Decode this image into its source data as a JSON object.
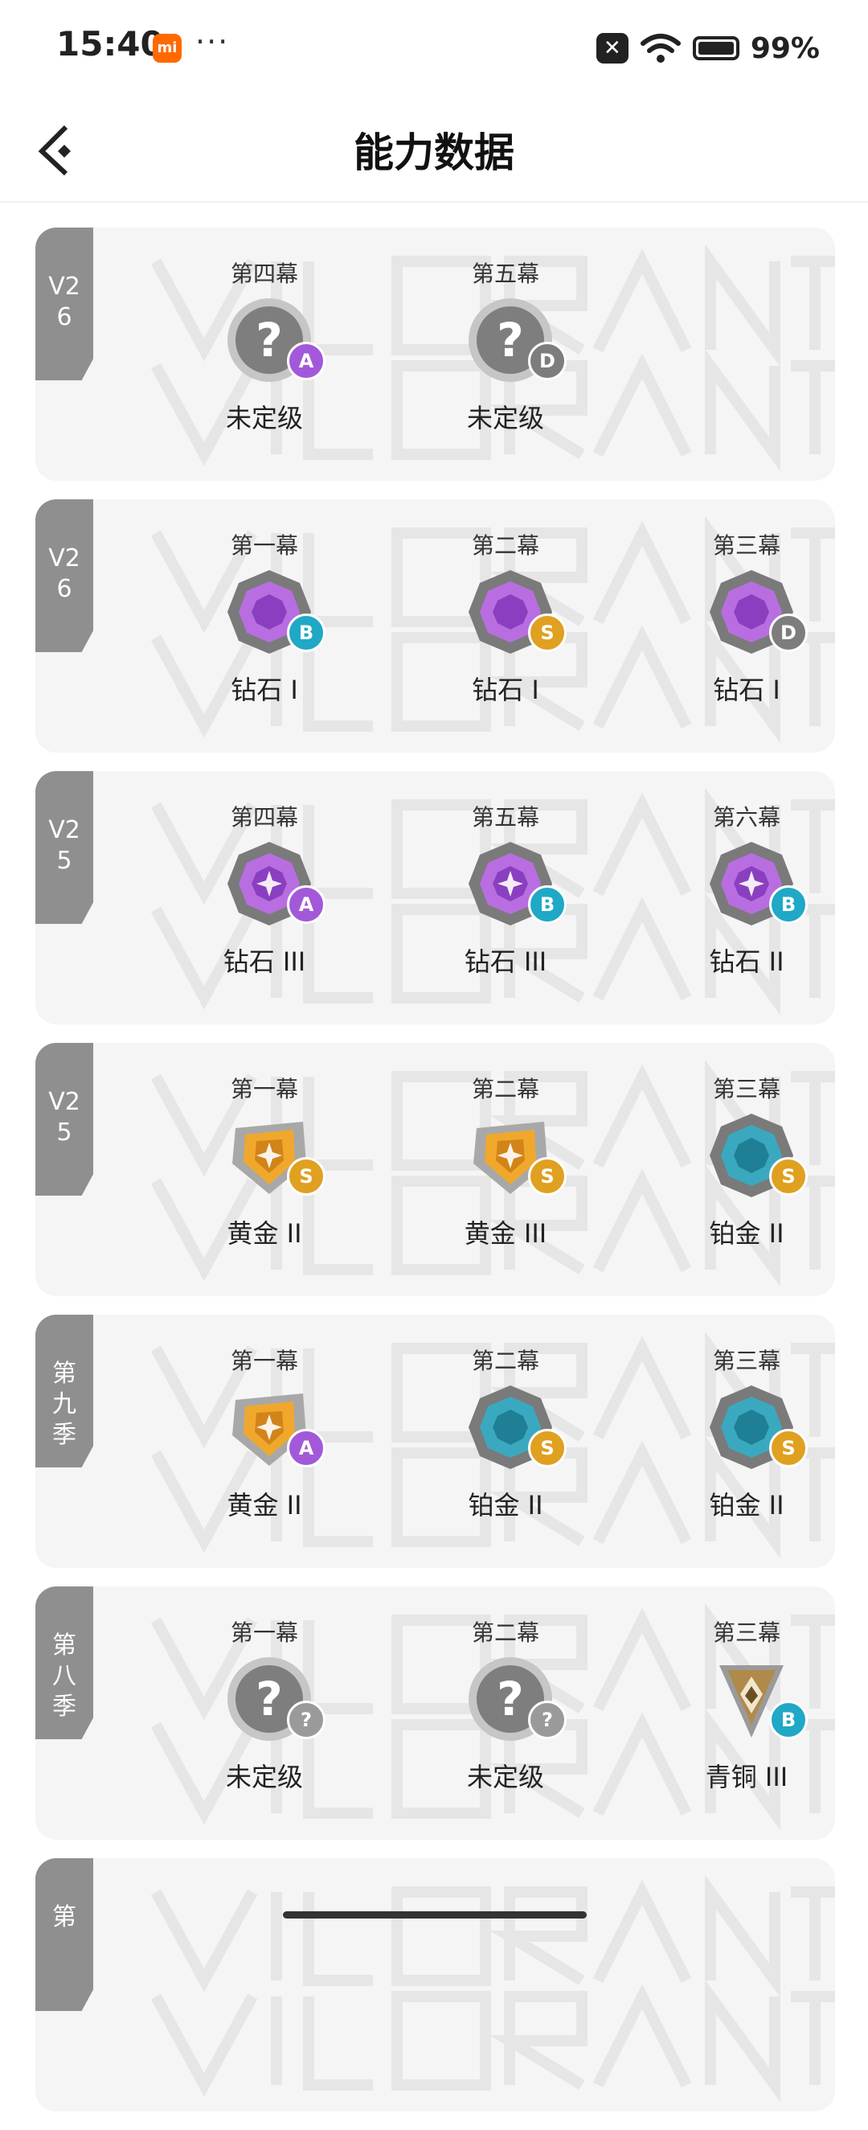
{
  "status_bar": {
    "time": "15:40",
    "mi_label": "mi",
    "dots": "···",
    "battery": "99%"
  },
  "header": {
    "title": "能力数据"
  },
  "colors": {
    "grade": {
      "A": "#a259d9",
      "B": "#1fa9c6",
      "S": "#e0a020",
      "D": "#7d7d7d",
      "?": "#9a9a9a"
    },
    "tag_bg": "#8f8f8f"
  },
  "seasons": [
    {
      "tag": "V2\n6",
      "acts": [
        {
          "label": "第四幕",
          "rank": "未定级",
          "tier": "unrated",
          "grade": "A"
        },
        {
          "label": "第五幕",
          "rank": "未定级",
          "tier": "unrated",
          "grade": "D"
        }
      ]
    },
    {
      "tag": "V2\n6",
      "acts": [
        {
          "label": "第一幕",
          "rank": "钻石 I",
          "tier": "diamond",
          "grade": "B"
        },
        {
          "label": "第二幕",
          "rank": "钻石 I",
          "tier": "diamond",
          "grade": "S"
        },
        {
          "label": "第三幕",
          "rank": "钻石 I",
          "tier": "diamond",
          "grade": "D"
        }
      ]
    },
    {
      "tag": "V2\n5",
      "acts": [
        {
          "label": "第四幕",
          "rank": "钻石 III",
          "tier": "diamond3",
          "grade": "A"
        },
        {
          "label": "第五幕",
          "rank": "钻石 III",
          "tier": "diamond3",
          "grade": "B"
        },
        {
          "label": "第六幕",
          "rank": "钻石 II",
          "tier": "diamond2",
          "grade": "B"
        }
      ]
    },
    {
      "tag": "V2\n5",
      "acts": [
        {
          "label": "第一幕",
          "rank": "黄金 II",
          "tier": "gold",
          "grade": "S"
        },
        {
          "label": "第二幕",
          "rank": "黄金 III",
          "tier": "gold",
          "grade": "S"
        },
        {
          "label": "第三幕",
          "rank": "铂金 II",
          "tier": "platinum",
          "grade": "S"
        }
      ]
    },
    {
      "tag": "第\n九\n季",
      "acts": [
        {
          "label": "第一幕",
          "rank": "黄金 II",
          "tier": "gold",
          "grade": "A"
        },
        {
          "label": "第二幕",
          "rank": "铂金 II",
          "tier": "platinum",
          "grade": "S"
        },
        {
          "label": "第三幕",
          "rank": "铂金 II",
          "tier": "platinum",
          "grade": "S"
        }
      ]
    },
    {
      "tag": "第\n八\n季",
      "acts": [
        {
          "label": "第一幕",
          "rank": "未定级",
          "tier": "unrated",
          "grade": "?"
        },
        {
          "label": "第二幕",
          "rank": "未定级",
          "tier": "unrated",
          "grade": "?"
        },
        {
          "label": "第三幕",
          "rank": "青铜 III",
          "tier": "bronze",
          "grade": "B"
        }
      ]
    },
    {
      "tag": "第",
      "acts": []
    }
  ]
}
